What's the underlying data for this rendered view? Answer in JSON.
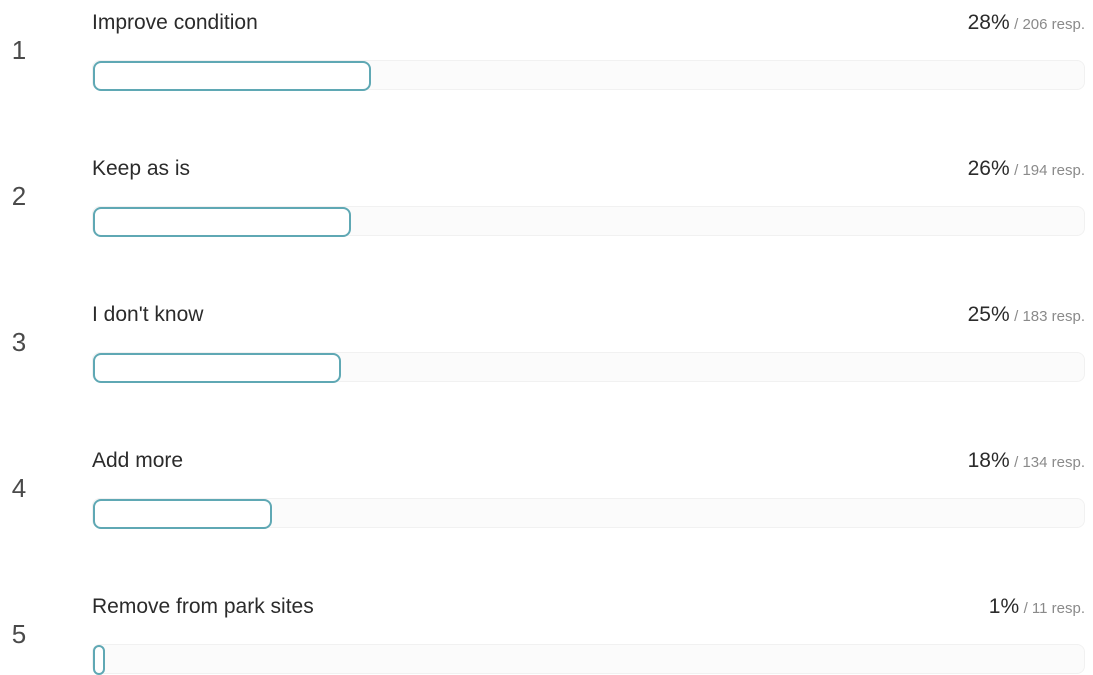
{
  "chart_data": {
    "type": "bar",
    "orientation": "horizontal",
    "rows": [
      {
        "rank": "1",
        "label": "Improve condition",
        "percent": "28%",
        "count": "/ 206 resp.",
        "value": 28
      },
      {
        "rank": "2",
        "label": "Keep as is",
        "percent": "26%",
        "count": "/ 194 resp.",
        "value": 26
      },
      {
        "rank": "3",
        "label": "I don't know",
        "percent": "25%",
        "count": "/ 183 resp.",
        "value": 25
      },
      {
        "rank": "4",
        "label": "Add more",
        "percent": "18%",
        "count": "/ 134 resp.",
        "value": 18
      },
      {
        "rank": "5",
        "label": "Remove from park sites",
        "percent": "1%",
        "count": "/ 11 resp.",
        "value": 1
      }
    ],
    "xlim": [
      0,
      100
    ],
    "bar_color": "#5fa8b4",
    "grid": false
  }
}
